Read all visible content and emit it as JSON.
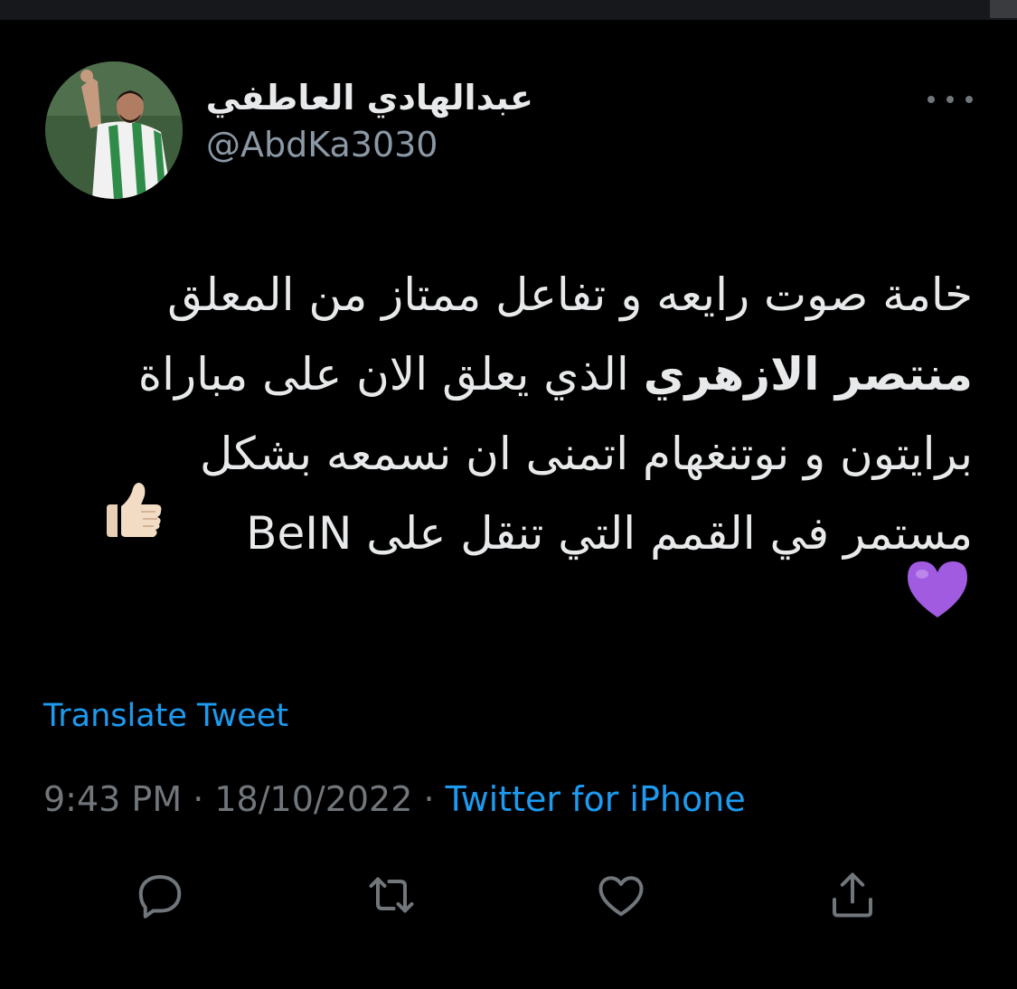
{
  "author": {
    "display_name": "عبدالهادي العاطفي",
    "handle": "@AbdKa3030",
    "avatar_icon": "user-avatar-photo"
  },
  "tweet": {
    "lines": [
      {
        "text": "خامة صوت رايعه و تفاعل ممتاز من المعلق"
      },
      {
        "bold": "منتصر الازهري",
        "text": " الذي يعلق الان على مباراة"
      },
      {
        "text": "برايتون و نوتنغهام اتمنى ان نسمعه بشكل"
      },
      {
        "text": "مستمر في القمم التي تنقل على BeIN"
      }
    ],
    "emojis": [
      "thumbs-up-light-skin-emoji",
      "purple-heart-emoji"
    ]
  },
  "translate_label": "Translate Tweet",
  "meta": {
    "time": "9:43 PM",
    "separator": " · ",
    "date": "18/10/2022",
    "source": "Twitter for iPhone"
  },
  "actions": [
    {
      "name": "reply-icon"
    },
    {
      "name": "retweet-icon"
    },
    {
      "name": "like-icon"
    },
    {
      "name": "share-icon"
    }
  ],
  "colors": {
    "background": "#000000",
    "text": "#e7e9ea",
    "secondary": "#71767b",
    "link": "#1d9bf0"
  }
}
